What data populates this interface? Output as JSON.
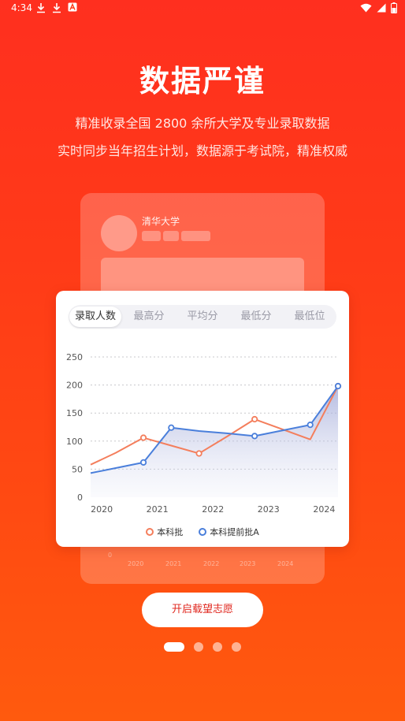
{
  "status_bar": {
    "time": "4:34",
    "left_icons": [
      "download-icon",
      "download-icon",
      "a-badge-icon"
    ],
    "right_icons": [
      "wifi-icon",
      "signal-icon",
      "battery-icon"
    ]
  },
  "hero": {
    "title": "数据严谨",
    "subtitle_line1": "精准收录全国 2800 余所大学及专业录取数据",
    "subtitle_line2": "实时同步当年招生计划，数据源于考试院，精准权威"
  },
  "back_card": {
    "school_name": "清华大学",
    "axis_labels": [
      "0",
      "2020",
      "2021",
      "2022",
      "2023",
      "2024"
    ]
  },
  "tabs": [
    {
      "label": "录取人数",
      "active": true
    },
    {
      "label": "最高分",
      "active": false
    },
    {
      "label": "平均分",
      "active": false
    },
    {
      "label": "最低分",
      "active": false
    },
    {
      "label": "最低位",
      "active": false
    }
  ],
  "chart_data": {
    "type": "line",
    "y_ticks": [
      0,
      50,
      100,
      150,
      200,
      250
    ],
    "x_ticks": [
      "2020",
      "2021",
      "2022",
      "2023",
      "2024"
    ],
    "ylim": [
      0,
      250
    ],
    "x_domain": [
      2019.8,
      2024.25
    ],
    "series": [
      {
        "name": "本科批",
        "color": "#f47e5c",
        "x": [
          2019.8,
          2020.25,
          2020.75,
          2021.25,
          2021.75,
          2022.25,
          2022.75,
          2023.25,
          2023.75,
          2024.25
        ],
        "values": [
          58,
          79,
          106,
          92,
          78,
          108,
          139,
          121,
          103,
          198
        ],
        "markers": [
          2,
          4,
          6,
          9
        ]
      },
      {
        "name": "本科提前批A",
        "color": "#4a7fdb",
        "x": [
          2019.8,
          2020.25,
          2020.75,
          2021.25,
          2021.75,
          2022.25,
          2022.75,
          2023.25,
          2023.75,
          2024.25
        ],
        "values": [
          43,
          52,
          62,
          124,
          118,
          114,
          109,
          119,
          129,
          198
        ],
        "markers": [
          2,
          3,
          6,
          8,
          9
        ],
        "area": true
      }
    ],
    "grid": "dashed-horizontal",
    "legend": "bottom-center"
  },
  "cta": {
    "label": "开启载望志愿"
  },
  "pager": {
    "count": 4,
    "active_index": 0
  },
  "colors": {
    "accent": "#ff3a18",
    "cta_text": "#e0281f"
  }
}
